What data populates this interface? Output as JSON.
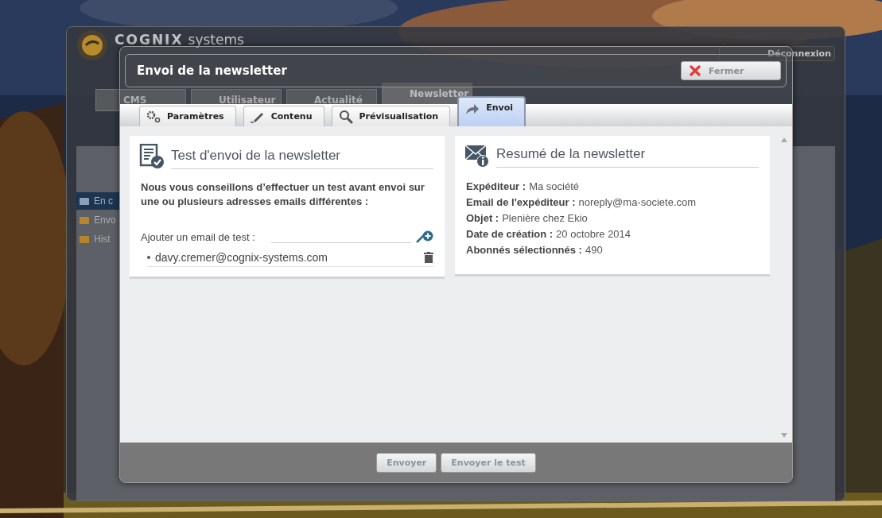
{
  "background_app": {
    "logo": {
      "name": "COGNIX",
      "tagline": "systems"
    },
    "logout_button": "Déconnexion",
    "tabs": [
      {
        "label": "CMS",
        "selected": false
      },
      {
        "label": "Utilisateur",
        "selected": false
      },
      {
        "label": "Actualité",
        "selected": false
      },
      {
        "label": "Newsletter",
        "selected": true
      }
    ],
    "sidebar": {
      "items": [
        {
          "label": "En c",
          "selected": true
        },
        {
          "label": "Envo",
          "selected": false
        },
        {
          "label": "Hist",
          "selected": false
        }
      ]
    }
  },
  "dialog": {
    "title": "Envoi de la newsletter",
    "close_button": "Fermer",
    "tabs": [
      {
        "label": "Paramètres",
        "selected": false
      },
      {
        "label": "Contenu",
        "selected": false
      },
      {
        "label": "Prévisualisation",
        "selected": false
      },
      {
        "label": "Envoi",
        "selected": true
      }
    ],
    "test_panel": {
      "title": "Test d'envoi de la newsletter",
      "intro": "Nous vous conseillons d’effectuer un test avant envoi sur une ou plusieurs adresses emails différentes :",
      "field_label": "Ajouter un email de test :",
      "emails": [
        "davy.cremer@cognix-systems.com"
      ]
    },
    "summary_panel": {
      "title": "Resumé de la newsletter",
      "rows": [
        {
          "label": "Expéditeur :",
          "value": "Ma société"
        },
        {
          "label": "Email de l'expéditeur :",
          "value": "noreply@ma-societe.com"
        },
        {
          "label": "Objet :",
          "value": "Plenière chez Ekio"
        },
        {
          "label": "Date de création :",
          "value": "20 octobre 2014"
        },
        {
          "label": "Abonnés sélectionnés :",
          "value": "490"
        }
      ]
    },
    "buttons": [
      "Envoyer",
      "Envoyer le test"
    ]
  }
}
